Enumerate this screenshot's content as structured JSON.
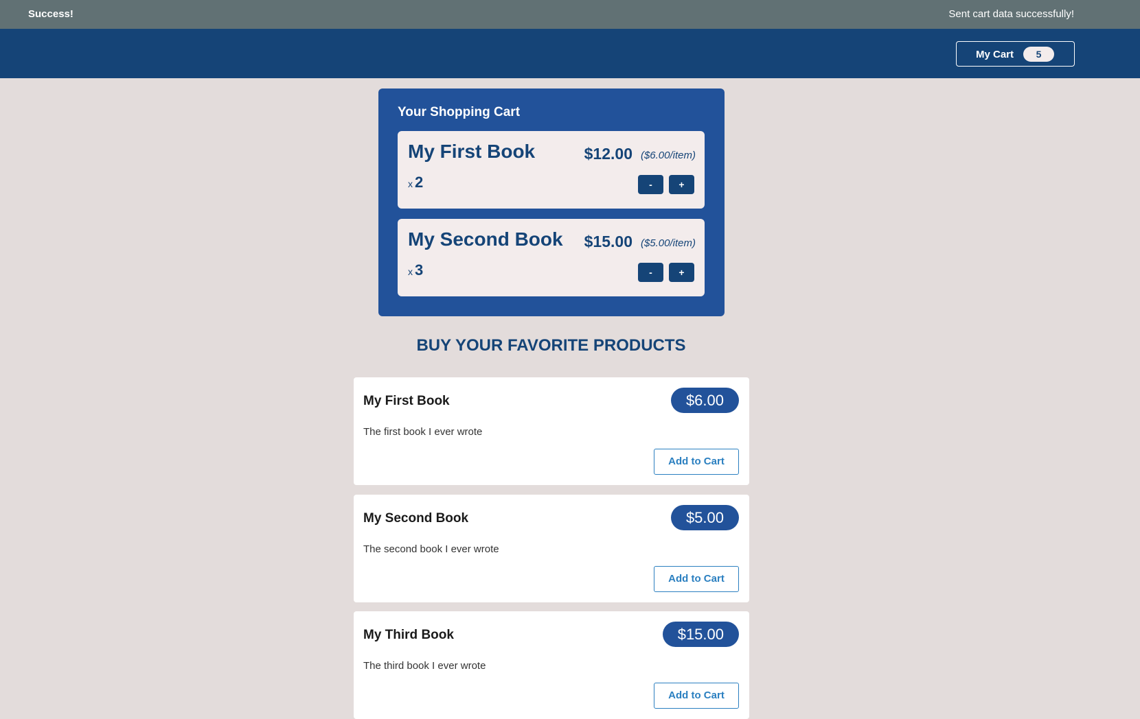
{
  "notification": {
    "title": "Success!",
    "message": "Sent cart data successfully!"
  },
  "header": {
    "cart_label": "My Cart",
    "cart_count": "5"
  },
  "cart": {
    "title": "Your Shopping Cart",
    "items": [
      {
        "name": "My First Book",
        "total": "$12.00",
        "each": "($6.00/item)",
        "x": "x",
        "quantity": "2",
        "minus": "-",
        "plus": "+"
      },
      {
        "name": "My Second Book",
        "total": "$15.00",
        "each": "($5.00/item)",
        "x": "x",
        "quantity": "3",
        "minus": "-",
        "plus": "+"
      }
    ]
  },
  "products": {
    "heading": "BUY YOUR FAVORITE PRODUCTS",
    "items": [
      {
        "name": "My First Book",
        "price": "$6.00",
        "description": "The first book I ever wrote",
        "button": "Add to Cart"
      },
      {
        "name": "My Second Book",
        "price": "$5.00",
        "description": "The second book I ever wrote",
        "button": "Add to Cart"
      },
      {
        "name": "My Third Book",
        "price": "$15.00",
        "description": "The third book I ever wrote",
        "button": "Add to Cart"
      }
    ]
  }
}
